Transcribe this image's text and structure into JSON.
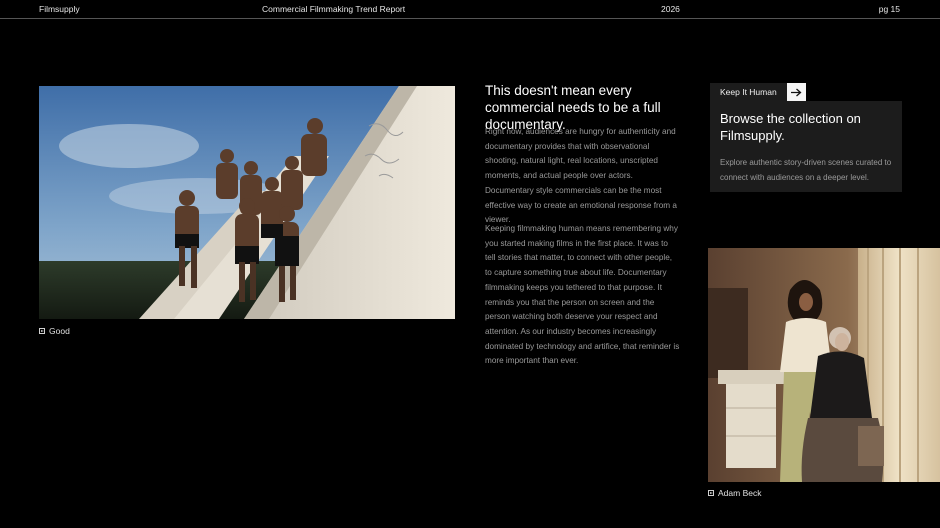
{
  "header": {
    "brand": "Filmsupply",
    "title": "Commercial Filmmaking Trend Report",
    "year": "2026",
    "page": "pg 15"
  },
  "article": {
    "headline": "This doesn't mean every commercial needs to be a full documentary.",
    "paragraphs": [
      "Right now, audiences are hungry for authenticity and documentary provides that with observational shooting, natural light, real locations, unscripted moments, and actual people over actors. Documentary style commercials can be the most effective way to create an emotional response from a viewer.",
      "Keeping filmmaking human means remembering why you started making films in the first place. It was to tell stories that matter, to connect with other people, to capture something true about life. Documentary filmmaking keeps you tethered to that purpose. It reminds you that the person on screen and the person watching both deserve your respect and attention. As our industry becomes increasingly dominated by technology and artifice, that reminder is more important than ever."
    ]
  },
  "card": {
    "tab_label": "Keep It Human",
    "arrow_icon": "arrow-right-icon",
    "title": "Browse the collection on Filmsupply.",
    "description": "Explore authentic story-driven scenes curated to connect with audiences on a deeper level."
  },
  "photos": {
    "left_caption": "Good",
    "right_caption": "Adam Beck",
    "caption_icon": "play-icon"
  }
}
